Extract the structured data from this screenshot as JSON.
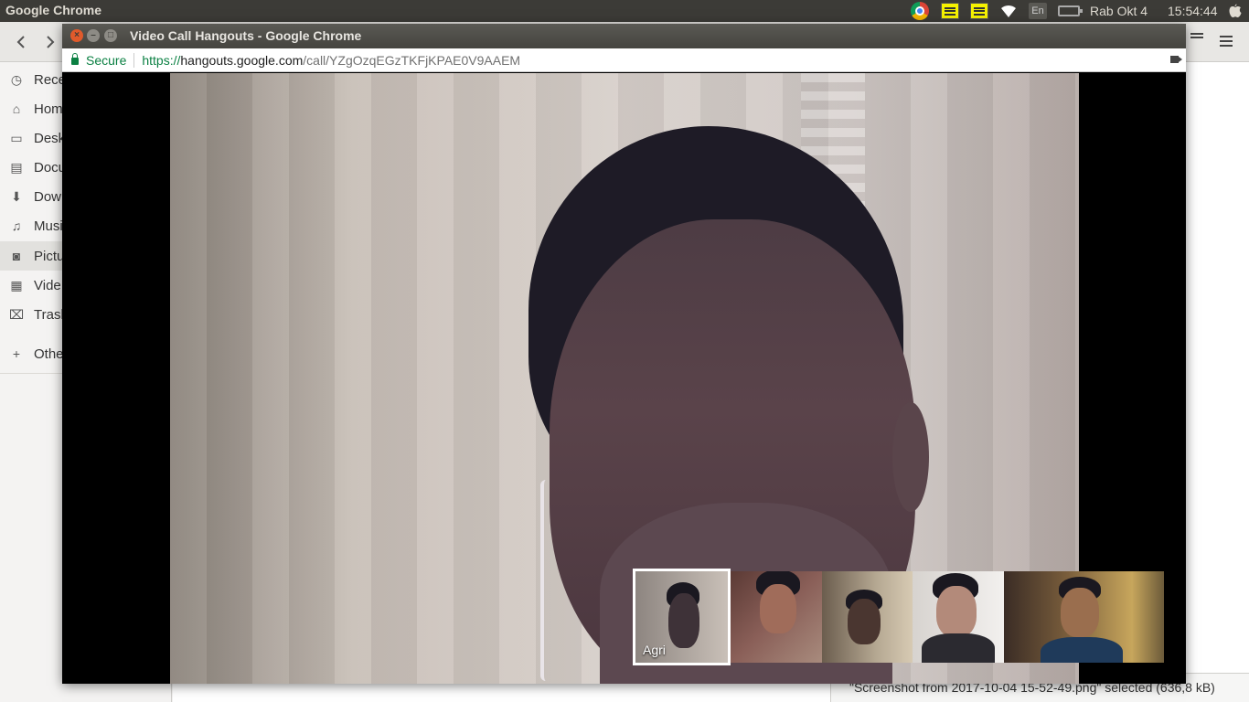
{
  "top_panel": {
    "app_name": "Google Chrome",
    "keyboard_layout": "En",
    "date": "Rab Okt  4",
    "time": "15:54:44"
  },
  "file_manager": {
    "sidebar": {
      "items": [
        {
          "label": "Rece",
          "icon": "recent-icon"
        },
        {
          "label": "Hom",
          "icon": "home-icon"
        },
        {
          "label": "Desk",
          "icon": "desktop-icon"
        },
        {
          "label": "Docu",
          "icon": "documents-icon"
        },
        {
          "label": "Dow",
          "icon": "downloads-icon"
        },
        {
          "label": "Musi",
          "icon": "music-icon"
        },
        {
          "label": "Pictu",
          "icon": "pictures-icon"
        },
        {
          "label": "Vide",
          "icon": "videos-icon"
        },
        {
          "label": "Trasl",
          "icon": "trash-icon"
        },
        {
          "label": "Othe",
          "icon": "plus-icon"
        }
      ]
    },
    "status": "\"Screenshot from 2017-10-04 15-52-49.png\" selected  (636,8 kB)"
  },
  "chrome_window": {
    "title": "Video Call Hangouts - Google Chrome",
    "security_label": "Secure",
    "url_scheme": "https://",
    "url_host": "hangouts.google.com",
    "url_path": "/call/YZgOzqEGzTKFjKPAE0V9AAEM"
  },
  "call": {
    "participants": [
      {
        "name": "Agri",
        "selected": true
      },
      {
        "name": "",
        "selected": false
      },
      {
        "name": "",
        "selected": false
      },
      {
        "name": "",
        "selected": false
      },
      {
        "name": "",
        "selected": false
      }
    ]
  },
  "colors": {
    "panel_bg": "#3c3b37",
    "secure_green": "#0b8043",
    "close_button": "#e05a2b",
    "note_yellow": "#f6f200"
  }
}
